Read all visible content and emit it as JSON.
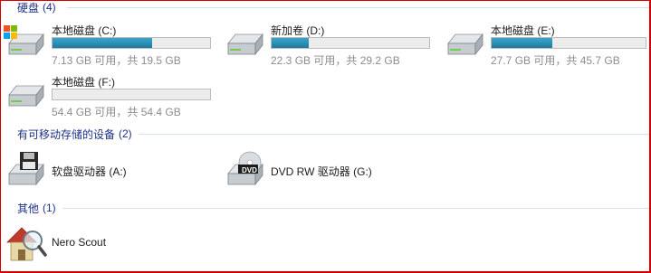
{
  "groups": {
    "hard_disks": {
      "label": "硬盘",
      "count": "(4)"
    },
    "removable": {
      "label": "有可移动存储的设备",
      "count": "(2)"
    },
    "other": {
      "label": "其他",
      "count": "(1)"
    }
  },
  "drives": [
    {
      "name": "本地磁盘 (C:)",
      "space": "7.13 GB 可用，共 19.5 GB",
      "used_fraction": 0.634,
      "icon": "system-drive-icon"
    },
    {
      "name": "新加卷 (D:)",
      "space": "22.3 GB 可用，共 29.2 GB",
      "used_fraction": 0.236,
      "icon": "hard-drive-icon"
    },
    {
      "name": "本地磁盘 (E:)",
      "space": "27.7 GB 可用，共 45.7 GB",
      "used_fraction": 0.394,
      "icon": "hard-drive-icon"
    },
    {
      "name": "本地磁盘 (F:)",
      "space": "54.4 GB 可用，共 54.4 GB",
      "used_fraction": 0.0,
      "icon": "hard-drive-icon"
    }
  ],
  "removable_devices": [
    {
      "name": "软盘驱动器 (A:)",
      "icon": "floppy-drive-icon"
    },
    {
      "name": "DVD RW 驱动器 (G:)",
      "icon": "dvd-drive-icon",
      "badge": "DVD"
    }
  ],
  "other_items": [
    {
      "name": "Nero Scout",
      "icon": "nero-scout-icon"
    }
  ],
  "colors": {
    "group_header": "#1e3287",
    "bar_fill": "#2b8fb4",
    "space_text": "#8d8d8d",
    "frame": "#d40000"
  }
}
